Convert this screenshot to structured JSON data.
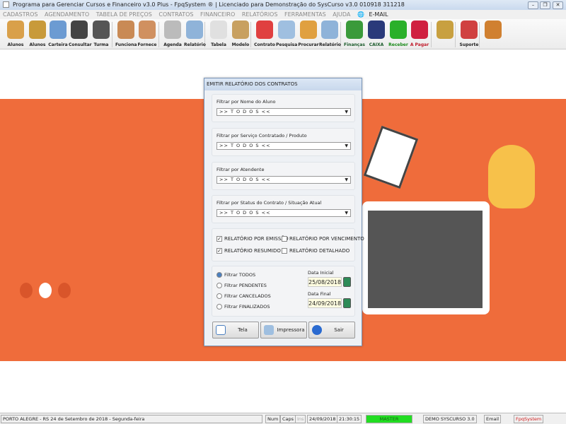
{
  "window": {
    "title": "Programa para Gerenciar Cursos e Financeiro v3.0 Plus - FpqSystem ® | Licenciado para  Demonstração do SysCurso v3.0 010918 311218"
  },
  "menu": [
    "CADASTROS",
    "AGENDAMENTO",
    "TABELA DE PREÇOS",
    "CONTRATOS",
    "FINANCEIRO",
    "RELATÓRIOS",
    "FERRAMENTAS",
    "AJUDA",
    "E-MAIL"
  ],
  "toolbar": [
    {
      "label": "Alunos",
      "color": "#d9a04a"
    },
    {
      "label": "Alunos",
      "color": "#c89a3a"
    },
    {
      "label": "Carteira",
      "color": "#6c9bd2"
    },
    {
      "label": "Consultar",
      "color": "#444444"
    },
    {
      "label": "Turma",
      "color": "#555555"
    },
    {
      "label": "Funciona",
      "color": "#c98a55"
    },
    {
      "label": "Fornece",
      "color": "#d09060"
    },
    {
      "label": "Agenda",
      "color": "#bbbbbb"
    },
    {
      "label": "Relatório",
      "color": "#8fb3d9"
    },
    {
      "label": "Tabela",
      "color": "#e0e0e0"
    },
    {
      "label": "Modelo",
      "color": "#c8a060"
    },
    {
      "label": "Contrato",
      "color": "#e04040"
    },
    {
      "label": "Pesquisa",
      "color": "#9fbfe0"
    },
    {
      "label": "Procurar",
      "color": "#e0a040"
    },
    {
      "label": "Relatório",
      "color": "#8fb3d9"
    },
    {
      "label": "Finanças",
      "color": "#3a9a3a"
    },
    {
      "label": "CAIXA",
      "color": "#2a3a7a"
    },
    {
      "label": "Receber",
      "color": "#2ab02a"
    },
    {
      "label": "A Pagar",
      "color": "#d02040"
    },
    {
      "label": "",
      "color": "#c8a040"
    },
    {
      "label": "Suporte",
      "color": "#d04040"
    },
    {
      "label": "",
      "color": "#d08030"
    }
  ],
  "dialog": {
    "title": "EMITIR RELATÓRIO DOS CONTRATOS",
    "filters": [
      {
        "label": "Filtrar por Nome do Aluno",
        "value": ">> T O D O S <<"
      },
      {
        "label": "Filtrar por Serviço Contratado / Produto",
        "value": ">> T O D O S <<"
      },
      {
        "label": "Filtrar por Atendente",
        "value": ">> T O D O S <<"
      },
      {
        "label": "Filtrar por Status do Contrato / Situação Atual",
        "value": ">> T O D O S <<"
      }
    ],
    "checkboxes": [
      {
        "label": "RELATÓRIO POR EMISSÃO",
        "checked": true
      },
      {
        "label": "RELATÓRIO POR VENCIMENTO",
        "checked": false
      },
      {
        "label": "RELATÓRIO RESUMIDO",
        "checked": true
      },
      {
        "label": "RELATÓRIO DETALHADO",
        "checked": false
      }
    ],
    "radios": [
      {
        "label": "Filtrar TODOS",
        "selected": true
      },
      {
        "label": "Filtrar PENDENTES",
        "selected": false
      },
      {
        "label": "Filtrar CANCELADOS",
        "selected": false
      },
      {
        "label": "Filtrar FINALIZADOS",
        "selected": false
      }
    ],
    "date_start_label": "Data Inicial",
    "date_start": "25/08/2018",
    "date_end_label": "Data Final",
    "date_end": "24/09/2018",
    "buttons": {
      "screen": "Tela",
      "print": "Impressora",
      "exit": "Sair"
    }
  },
  "status": {
    "location": "PORTO ALEGRE - RS 24 de Setembro de 2018 - Segunda-feira",
    "num": "Num",
    "caps": "Caps",
    "ins": "Ins",
    "date": "24/09/2018",
    "time": "21:30:15",
    "user": "MASTER",
    "db": "DEMO SYSCURSO 3.0",
    "email": "Email",
    "brand": "FpqSystem"
  }
}
